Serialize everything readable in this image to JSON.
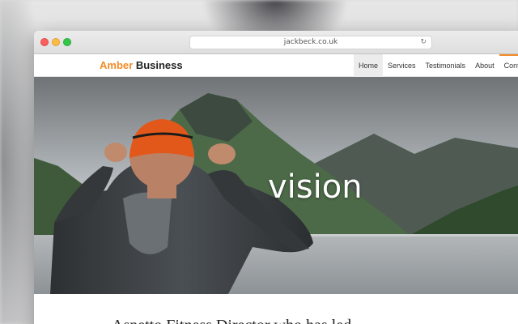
{
  "browser": {
    "url": "jackbeck.co.uk",
    "reload_icon": "reload-icon"
  },
  "site": {
    "brand_accent": "Amber",
    "brand_rest": "Business",
    "brand_color": "#f28c28"
  },
  "nav": {
    "items": [
      {
        "label": "Home",
        "active": true
      },
      {
        "label": "Services"
      },
      {
        "label": "Testimonials"
      },
      {
        "label": "About"
      },
      {
        "label": "Contact"
      }
    ]
  },
  "hero": {
    "word": "vision"
  },
  "below": {
    "text": "Aspetto Fitness Director who has led"
  }
}
